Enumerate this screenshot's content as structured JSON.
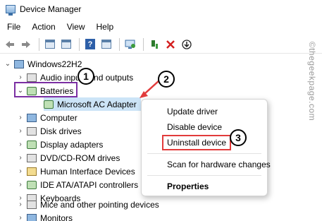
{
  "window": {
    "title": "Device Manager"
  },
  "menu": [
    "File",
    "Action",
    "View",
    "Help"
  ],
  "toolbar": {
    "buttons": [
      "back-arrow-icon",
      "forward-arrow-icon",
      "show-hide-tree-icon",
      "properties-icon",
      "help-icon",
      "scan-hardware-icon",
      "update-driver-icon",
      "enable-device-icon",
      "uninstall-x-icon",
      "download-icon"
    ],
    "help_glyph": "?"
  },
  "tree": {
    "root": "Windows22H2",
    "items": [
      {
        "label": "Audio inputs and outputs",
        "expanded": false
      },
      {
        "label": "Batteries",
        "expanded": true
      },
      {
        "label": "Microsoft AC Adapter",
        "child": true,
        "selected": true
      },
      {
        "label": "Computer",
        "expanded": false
      },
      {
        "label": "Disk drives",
        "expanded": false
      },
      {
        "label": "Display adapters",
        "expanded": false
      },
      {
        "label": "DVD/CD-ROM drives",
        "expanded": false
      },
      {
        "label": "Human Interface Devices",
        "expanded": false
      },
      {
        "label": "IDE ATA/ATAPI controllers",
        "expanded": false
      },
      {
        "label": "Keyboards",
        "expanded": false
      },
      {
        "label": "Mice and other pointing devices",
        "expanded": false
      },
      {
        "label": "Monitors",
        "expanded": false
      }
    ],
    "chevron_collapsed": "›",
    "chevron_expanded": "⌄"
  },
  "context_menu": {
    "items": [
      "Update driver",
      "Disable device",
      "Uninstall device",
      "Scan for hardware changes",
      "Properties"
    ]
  },
  "annotations": {
    "badges": [
      "1",
      "2",
      "3"
    ],
    "highlight_color": "#7b2fa3",
    "arrow_color": "#e23b3b"
  },
  "watermark": "©thegeekpage.com"
}
